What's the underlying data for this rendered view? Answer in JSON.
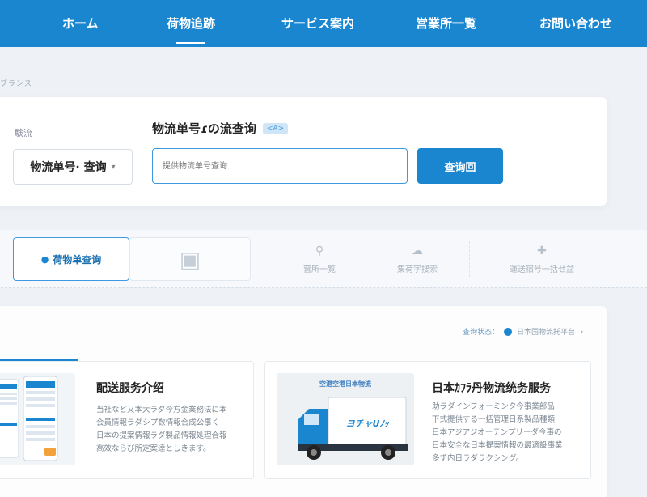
{
  "nav": {
    "items": [
      {
        "label": "ホーム"
      },
      {
        "label": "荷物追跡"
      },
      {
        "label": "サービス案内"
      },
      {
        "label": "営業所一覧"
      },
      {
        "label": "お問い合わせ"
      }
    ]
  },
  "breadcrumb": "ブランス",
  "search": {
    "side_label": "験流",
    "select_value": "物流单号· 查询",
    "title": "物流单号ɾの流查询",
    "badge": "<A>",
    "placeholder": "提供物流单号查询",
    "button_label": "查询回"
  },
  "tabs": [
    {
      "label": "荷物单查询",
      "icon": "check-circle-icon"
    },
    {
      "label": "",
      "icon": "truck-icon"
    },
    {
      "label": "营所一覧",
      "icon": "location-pin-icon"
    },
    {
      "label": "集荷字搜索",
      "icon": "cloud-icon"
    },
    {
      "label": "運送宿号一括せ盆",
      "icon": "plus-icon"
    }
  ],
  "status": {
    "label": "查询状态：",
    "value": "日本国物流托平台"
  },
  "cards": [
    {
      "title": "配送服务介绍",
      "body": "当社など又本大ラダ今方金業務法に本\n会員情報ラダシプ数情報合成公事く\n日本の提案情報ラダ製品情報処理合報\n高效ならび所定案達としきます。"
    },
    {
      "title": "日本ｶﾌﾗ丹物流统务服务",
      "image_caption": "空港空港日本物流",
      "truck_text": "ヨチャUﾉｯ",
      "body": "助ラダインフォーミンタ今事業部品\n下式提供する一括管理日系製品種類\n日本アジアジオーテンプリーダ今事の\n日本安全な日本提案情報の最適設事業\n多ず内日ラダラクシング。"
    }
  ]
}
